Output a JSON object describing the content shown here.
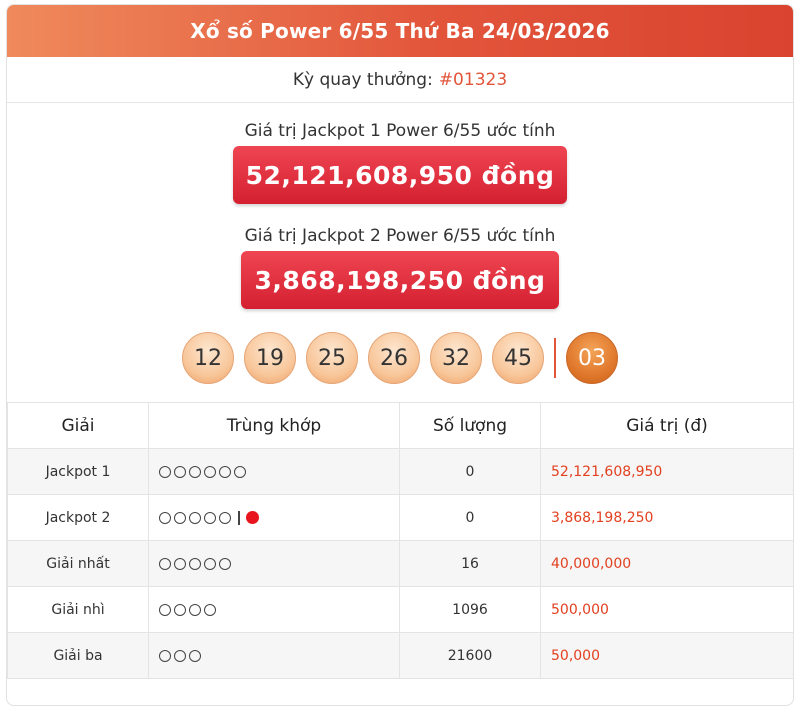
{
  "header": {
    "title": "Xổ số Power 6/55 Thứ Ba 24/03/2026"
  },
  "draw": {
    "label": "Kỳ quay thưởng:",
    "number": "#01323"
  },
  "jackpot1": {
    "label": "Giá trị Jackpot 1 Power 6/55 ước tính",
    "value": "52,121,608,950 đồng"
  },
  "jackpot2": {
    "label": "Giá trị Jackpot 2 Power 6/55 ước tính",
    "value": "3,868,198,250 đồng"
  },
  "results": {
    "balls": [
      "12",
      "19",
      "25",
      "26",
      "32",
      "45"
    ],
    "power_ball": "03"
  },
  "table": {
    "headers": [
      "Giải",
      "Trùng khớp",
      "Số lượng",
      "Giá trị (đ)"
    ],
    "rows": [
      {
        "name": "Jackpot 1",
        "circles": 6,
        "power": false,
        "qty": "0",
        "value": "52,121,608,950"
      },
      {
        "name": "Jackpot 2",
        "circles": 5,
        "power": true,
        "qty": "0",
        "value": "3,868,198,250"
      },
      {
        "name": "Giải nhất",
        "circles": 5,
        "power": false,
        "qty": "16",
        "value": "40,000,000"
      },
      {
        "name": "Giải nhì",
        "circles": 4,
        "power": false,
        "qty": "1096",
        "value": "500,000"
      },
      {
        "name": "Giải ba",
        "circles": 3,
        "power": false,
        "qty": "21600",
        "value": "50,000"
      }
    ]
  },
  "colors": {
    "header_start": "#ef8a5c",
    "header_end": "#d9432f",
    "jackpot_bg": "#d42030",
    "value_text": "#e2401f",
    "power_ball": "#e0782c",
    "power_dot": "#e8141e"
  },
  "icons": {
    "match_circle": "circle-outline-icon",
    "power_dot": "red-dot-icon"
  }
}
